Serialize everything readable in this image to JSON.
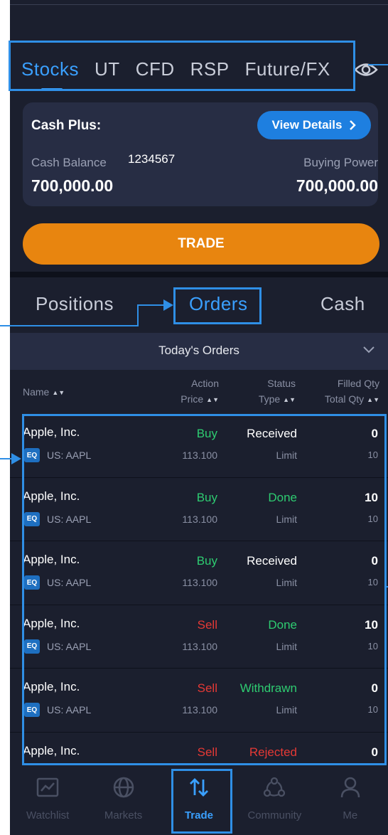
{
  "asset_tabs": [
    "Stocks",
    "UT",
    "CFD",
    "RSP",
    "Future/FX"
  ],
  "cash_card": {
    "title": "Cash Plus:",
    "view_details": "View Details",
    "cash_balance_label": "Cash Balance",
    "account_id": "1234567",
    "buying_power_label": "Buying Power",
    "cash_balance": "700,000.00",
    "buying_power": "700,000.00"
  },
  "trade_button": "TRADE",
  "section_tabs": [
    "Positions",
    "Orders",
    "Cash"
  ],
  "today_orders": "Today's Orders",
  "columns": {
    "name": "Name",
    "action": "Action",
    "price": "Price",
    "status": "Status",
    "type": "Type",
    "filled_qty": "Filled Qty",
    "total_qty": "Total Qty"
  },
  "orders": [
    {
      "name": "Apple, Inc.",
      "badge": "EQ",
      "symbol": "US: AAPL",
      "action": "Buy",
      "price": "113.100",
      "status": "Received",
      "type": "Limit",
      "filled": "0",
      "total": "10"
    },
    {
      "name": "Apple, Inc.",
      "badge": "EQ",
      "symbol": "US: AAPL",
      "action": "Buy",
      "price": "113.100",
      "status": "Done",
      "type": "Limit",
      "filled": "10",
      "total": "10"
    },
    {
      "name": "Apple, Inc.",
      "badge": "EQ",
      "symbol": "US: AAPL",
      "action": "Buy",
      "price": "113.100",
      "status": "Received",
      "type": "Limit",
      "filled": "0",
      "total": "10"
    },
    {
      "name": "Apple, Inc.",
      "badge": "EQ",
      "symbol": "US: AAPL",
      "action": "Sell",
      "price": "113.100",
      "status": "Done",
      "type": "Limit",
      "filled": "10",
      "total": "10"
    },
    {
      "name": "Apple, Inc.",
      "badge": "EQ",
      "symbol": "US: AAPL",
      "action": "Sell",
      "price": "113.100",
      "status": "Withdrawn",
      "type": "Limit",
      "filled": "0",
      "total": "10"
    },
    {
      "name": "Apple, Inc.",
      "badge": "",
      "symbol": "",
      "action": "Sell",
      "price": "",
      "status": "Rejected",
      "type": "",
      "filled": "0",
      "total": ""
    }
  ],
  "bottom_nav": [
    "Watchlist",
    "Markets",
    "Trade",
    "Community",
    "Me"
  ],
  "colors": {
    "buy": "#2ecc71",
    "sell": "#e53935",
    "done": "#2ecc71",
    "withdrawn": "#2ecc71",
    "rejected": "#e53935",
    "received": "#ffffff",
    "accent": "#3aa0ff",
    "trade": "#e8850f"
  }
}
